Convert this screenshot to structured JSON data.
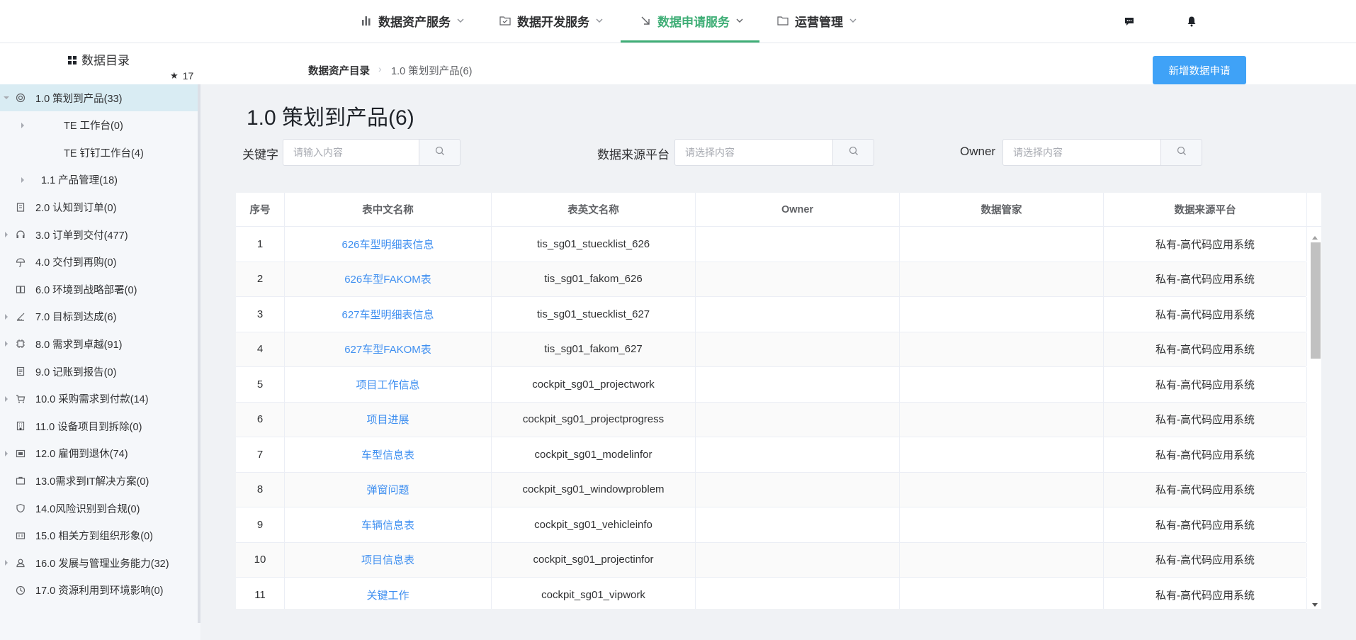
{
  "nav": {
    "items": [
      {
        "label": "数据资产服务",
        "icon": "bar-chart-icon"
      },
      {
        "label": "数据开发服务",
        "icon": "folder-check-icon"
      },
      {
        "label": "数据申请服务",
        "icon": "arrow-down-right-icon"
      },
      {
        "label": "运营管理",
        "icon": "folder-icon"
      }
    ],
    "active_index": 2,
    "accent": "#3fae76"
  },
  "sidebar": {
    "title": "数据目录",
    "star_count": "17",
    "items": [
      {
        "label": "1.0 策划到产品(33)",
        "icon": "target-icon",
        "selected": true,
        "expanded": true
      },
      {
        "label": "TE 工作台(0)",
        "child": true
      },
      {
        "label": "TE 钉钉工作台(4)",
        "child": true
      },
      {
        "label": "1.1 产品管理(18)",
        "child": true
      },
      {
        "label": "2.0 认知到订单(0)",
        "icon": "clipboard-icon"
      },
      {
        "label": "3.0 订单到交付(477)",
        "icon": "headset-icon"
      },
      {
        "label": "4.0 交付到再购(0)",
        "icon": "umbrella-icon"
      },
      {
        "label": "6.0 环境到战略部署(0)",
        "icon": "book-icon"
      },
      {
        "label": "7.0 目标到达成(6)",
        "icon": "ruler-icon"
      },
      {
        "label": "8.0 需求到卓越(91)",
        "icon": "chip-icon"
      },
      {
        "label": "9.0 记账到报告(0)",
        "icon": "document-icon"
      },
      {
        "label": "10.0 采购需求到付款(14)",
        "icon": "cart-icon"
      },
      {
        "label": "11.0 设备项目到拆除(0)",
        "icon": "building-icon"
      },
      {
        "label": "12.0 雇佣到退休(74)",
        "icon": "picture-icon"
      },
      {
        "label": "13.0需求到IT解决方案(0)",
        "icon": "suitcase-icon"
      },
      {
        "label": "14.0风险识别到合规(0)",
        "icon": "shield-icon"
      },
      {
        "label": "15.0 相关方到组织形象(0)",
        "icon": "id-card-icon"
      },
      {
        "label": "16.0 发展与管理业务能力(32)",
        "icon": "user-icon"
      },
      {
        "label": "17.0 资源利用到环境影响(0)",
        "icon": "clock-icon"
      }
    ]
  },
  "breadcrumb": {
    "root": "数据资产目录",
    "current": "1.0 策划到产品(6)"
  },
  "new_request_button": "新增数据申请",
  "page_title": "1.0 策划到产品(6)",
  "filters": {
    "keyword": {
      "label": "关键字",
      "placeholder": "请输入内容"
    },
    "platform": {
      "label": "数据来源平台",
      "placeholder": "请选择内容"
    },
    "owner": {
      "label": "Owner",
      "placeholder": "请选择内容"
    }
  },
  "table": {
    "headers": [
      "序号",
      "表中文名称",
      "表英文名称",
      "Owner",
      "数据管家",
      "数据来源平台"
    ],
    "rows": [
      {
        "no": "1",
        "cn": "626车型明细表信息",
        "en": "tis_sg01_stuecklist_626",
        "owner": "",
        "steward": "",
        "platform": "私有-高代码应用系统"
      },
      {
        "no": "2",
        "cn": "626车型FAKOM表",
        "en": "tis_sg01_fakom_626",
        "owner": "",
        "steward": "",
        "platform": "私有-高代码应用系统"
      },
      {
        "no": "3",
        "cn": "627车型明细表信息",
        "en": "tis_sg01_stuecklist_627",
        "owner": "",
        "steward": "",
        "platform": "私有-高代码应用系统"
      },
      {
        "no": "4",
        "cn": "627车型FAKOM表",
        "en": "tis_sg01_fakom_627",
        "owner": "",
        "steward": "",
        "platform": "私有-高代码应用系统"
      },
      {
        "no": "5",
        "cn": "项目工作信息",
        "en": "cockpit_sg01_projectwork",
        "owner": "",
        "steward": "",
        "platform": "私有-高代码应用系统"
      },
      {
        "no": "6",
        "cn": "项目进展",
        "en": "cockpit_sg01_projectprogress",
        "owner": "",
        "steward": "",
        "platform": "私有-高代码应用系统"
      },
      {
        "no": "7",
        "cn": "车型信息表",
        "en": "cockpit_sg01_modelinfor",
        "owner": "",
        "steward": "",
        "platform": "私有-高代码应用系统"
      },
      {
        "no": "8",
        "cn": "弹窗问题",
        "en": "cockpit_sg01_windowproblem",
        "owner": "",
        "steward": "",
        "platform": "私有-高代码应用系统"
      },
      {
        "no": "9",
        "cn": "车辆信息表",
        "en": "cockpit_sg01_vehicleinfo",
        "owner": "",
        "steward": "",
        "platform": "私有-高代码应用系统"
      },
      {
        "no": "10",
        "cn": "项目信息表",
        "en": "cockpit_sg01_projectinfor",
        "owner": "",
        "steward": "",
        "platform": "私有-高代码应用系统"
      },
      {
        "no": "11",
        "cn": "关键工作",
        "en": "cockpit_sg01_vipwork",
        "owner": "",
        "steward": "",
        "platform": "私有-高代码应用系统"
      }
    ]
  },
  "colors": {
    "primary": "#3fa2f7",
    "link": "#3f8ff0",
    "selected_bg": "#d9ecf3"
  }
}
